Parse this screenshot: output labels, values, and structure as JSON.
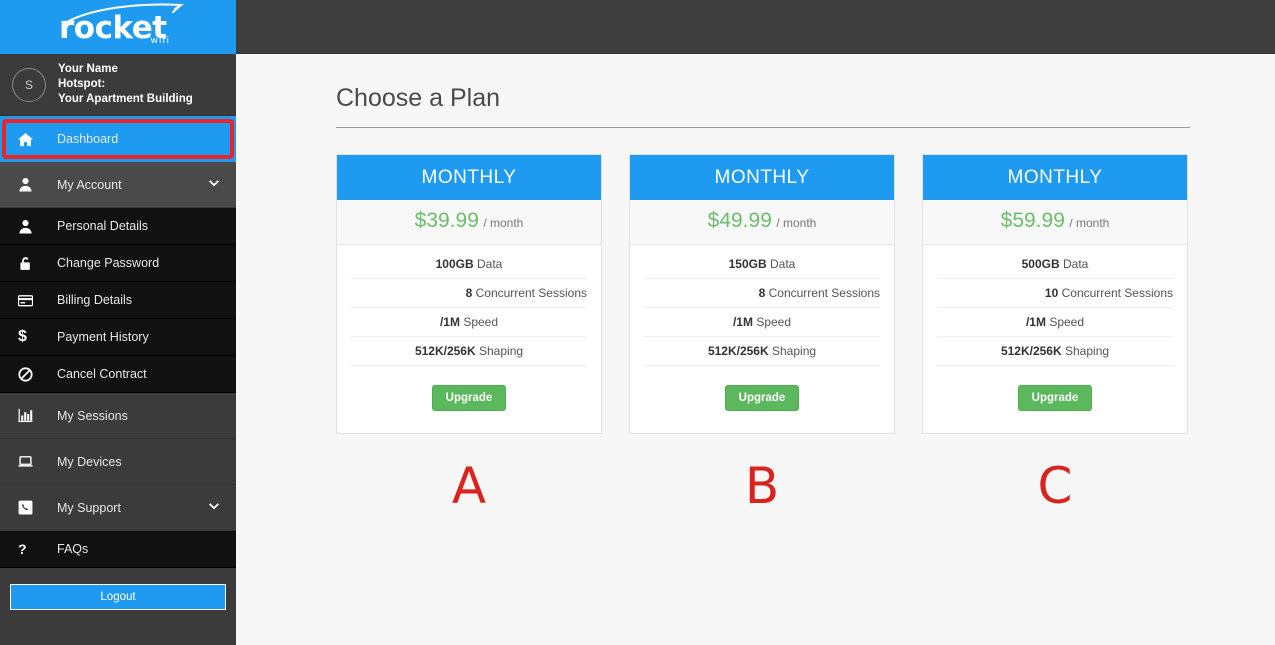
{
  "brand": {
    "logo_text": "rocket",
    "logo_sub": "wifi",
    "logo_bg": "#1e9bf0"
  },
  "profile": {
    "avatar_initial": "S",
    "name": "Your Name",
    "hotspot_label": "Hotspot:",
    "hotspot_value": "Your Apartment Building"
  },
  "sidebar": {
    "items": [
      {
        "label": "Dashboard",
        "icon": "home-icon",
        "type": "active",
        "chevron": ""
      },
      {
        "label": "My Account",
        "icon": "user-icon",
        "type": "group",
        "chevron": "❯"
      },
      {
        "label": "Personal Details",
        "icon": "user-icon",
        "type": "sub",
        "chevron": ""
      },
      {
        "label": "Change Password",
        "icon": "lock-icon",
        "type": "sub",
        "chevron": ""
      },
      {
        "label": "Billing Details",
        "icon": "credit-card-icon",
        "type": "sub",
        "chevron": ""
      },
      {
        "label": "Payment History",
        "icon": "dollar-icon",
        "type": "sub",
        "chevron": ""
      },
      {
        "label": "Cancel Contract",
        "icon": "ban-icon",
        "type": "sub",
        "chevron": ""
      },
      {
        "label": "My Sessions",
        "icon": "bar-chart-icon",
        "type": "plain",
        "chevron": ""
      },
      {
        "label": "My Devices",
        "icon": "laptop-icon",
        "type": "plain",
        "chevron": ""
      },
      {
        "label": "My Support",
        "icon": "phone-icon",
        "type": "plain",
        "chevron": "❯"
      },
      {
        "label": "FAQs",
        "icon": "question-icon",
        "type": "sub-dark",
        "chevron": ""
      }
    ],
    "logout_label": "Logout",
    "highlight_color": "#e8252a"
  },
  "main": {
    "page_title": "Choose a Plan",
    "accent_blue": "#1e9bf0",
    "price_green": "#6bbf6b",
    "button_green": "#5cb85c",
    "plans": [
      {
        "header": "MONTHLY",
        "price": "$39.99",
        "period": "/ month",
        "features": [
          {
            "value": "100GB",
            "label": "Data"
          },
          {
            "value": "8",
            "label": "Concurrent Sessions"
          },
          {
            "value": "/1M",
            "label": "Speed"
          },
          {
            "value": "512K/256K",
            "label": "Shaping"
          }
        ],
        "cta": "Upgrade",
        "marker": "A"
      },
      {
        "header": "MONTHLY",
        "price": "$49.99",
        "period": "/ month",
        "features": [
          {
            "value": "150GB",
            "label": "Data"
          },
          {
            "value": "8",
            "label": "Concurrent Sessions"
          },
          {
            "value": "/1M",
            "label": "Speed"
          },
          {
            "value": "512K/256K",
            "label": "Shaping"
          }
        ],
        "cta": "Upgrade",
        "marker": "B"
      },
      {
        "header": "MONTHLY",
        "price": "$59.99",
        "period": "/ month",
        "features": [
          {
            "value": "500GB",
            "label": "Data"
          },
          {
            "value": "10",
            "label": "Concurrent Sessions"
          },
          {
            "value": "/1M",
            "label": "Speed"
          },
          {
            "value": "512K/256K",
            "label": "Shaping"
          }
        ],
        "cta": "Upgrade",
        "marker": "C"
      }
    ],
    "marker_color": "#d9231f"
  }
}
